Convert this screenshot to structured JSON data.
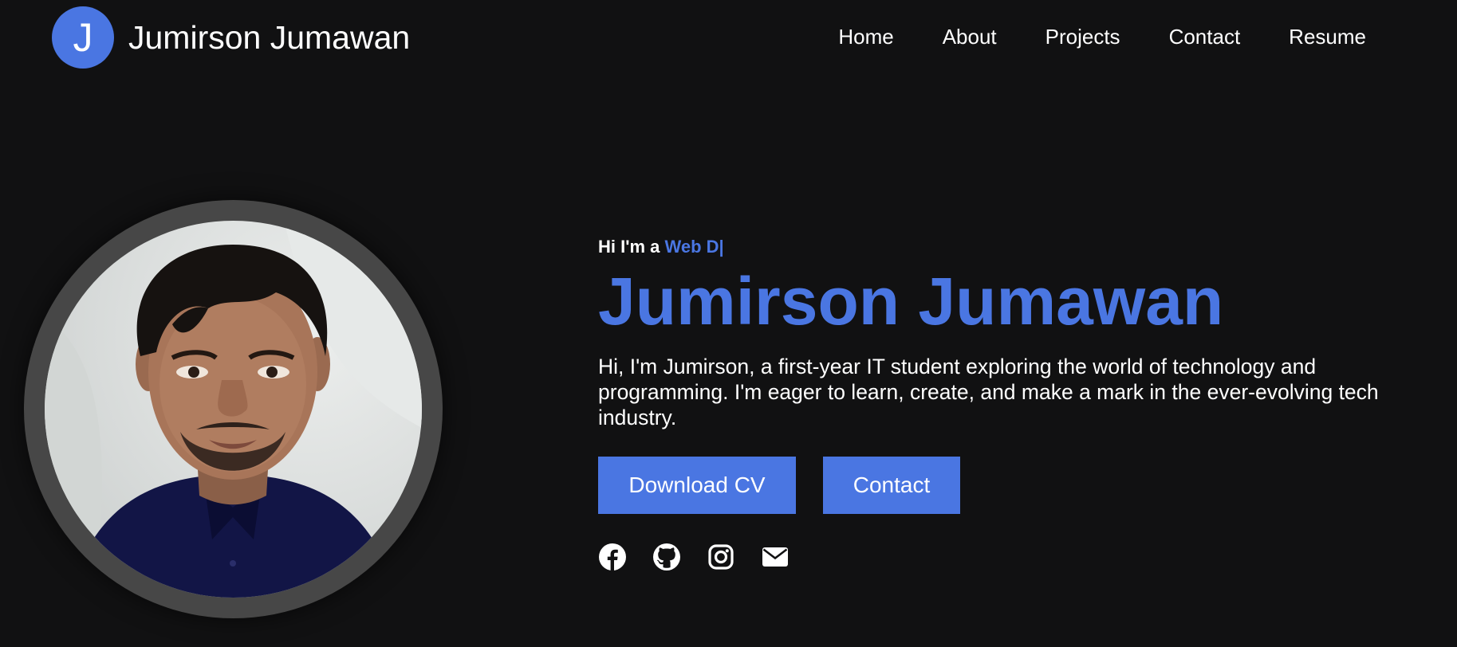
{
  "header": {
    "logo_letter": "J",
    "logo_name": "Jumirson Jumawan",
    "nav": [
      {
        "label": "Home"
      },
      {
        "label": "About"
      },
      {
        "label": "Projects"
      },
      {
        "label": "Contact"
      },
      {
        "label": "Resume"
      }
    ]
  },
  "hero": {
    "greeting_prefix": "Hi I'm a ",
    "greeting_role": "Web D|",
    "name": "Jumirson Jumawan",
    "bio": "Hi, I'm Jumirson, a first-year IT student exploring the world of technology and programming. I'm eager to learn, create, and make a mark in the ever-evolving tech industry.",
    "buttons": {
      "download_cv": "Download CV",
      "contact": "Contact"
    },
    "socials": [
      {
        "icon": "facebook-icon"
      },
      {
        "icon": "github-icon"
      },
      {
        "icon": "instagram-icon"
      },
      {
        "icon": "email-icon"
      }
    ]
  },
  "colors": {
    "background": "#111112",
    "accent": "#4a76e2",
    "text": "#ffffff",
    "photo_ring": "#474747"
  }
}
